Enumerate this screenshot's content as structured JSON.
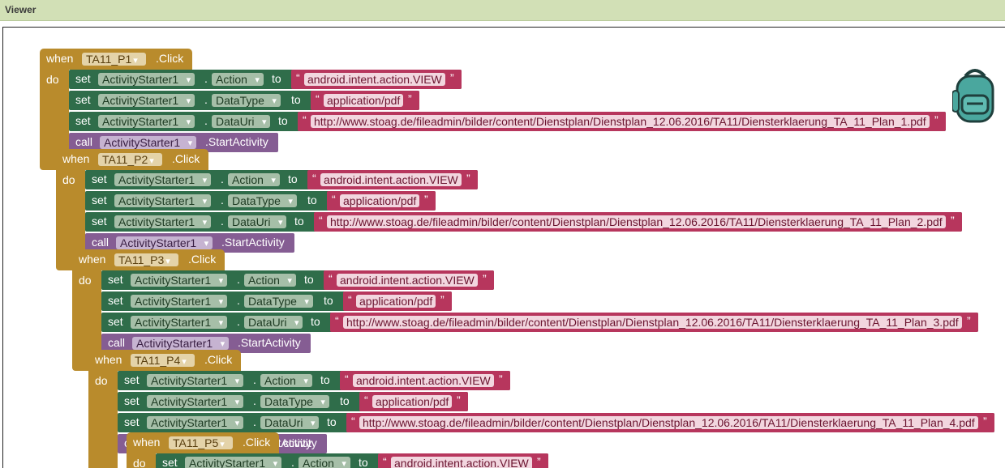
{
  "header": {
    "title": "Viewer"
  },
  "blocks": {
    "when_label": "when",
    "do_label": "do",
    "click_label": ".Click",
    "set_label": "set",
    "to_label": "to",
    "call_label": "call",
    "dot_label": ".",
    "start_activity": ".StartActivity",
    "component": "ActivityStarter1",
    "action_prop": "Action",
    "datatype_prop": "DataType",
    "datauri_prop": "DataUri",
    "action_value": "android.intent.action.VIEW",
    "datatype_value": "application/pdf",
    "quote_open": "“",
    "quote_close": "”"
  },
  "events": [
    {
      "button": "TA11_P1",
      "uri": "http://www.stoag.de/fileadmin/bilder/content/Dienstplan/Dienstplan_12.06.2016/TA11/Diensterklaerung_TA_11_Plan_1.pdf"
    },
    {
      "button": "TA11_P2",
      "uri": "http://www.stoag.de/fileadmin/bilder/content/Dienstplan/Dienstplan_12.06.2016/TA11/Diensterklaerung_TA_11_Plan_2.pdf"
    },
    {
      "button": "TA11_P3",
      "uri": "http://www.stoag.de/fileadmin/bilder/content/Dienstplan/Dienstplan_12.06.2016/TA11/Diensterklaerung_TA_11_Plan_3.pdf"
    },
    {
      "button": "TA11_P4",
      "uri": "http://www.stoag.de/fileadmin/bilder/content/Dienstplan/Dienstplan_12.06.2016/TA11/Diensterklaerung_TA_11_Plan_4.pdf"
    },
    {
      "button": "TA11_P5",
      "uri": ""
    }
  ],
  "partial_text": {
    "p4_call_tail": "ctivity"
  },
  "icons": {
    "backpack": "backpack-icon"
  },
  "colors": {
    "event": "#b98b2c",
    "setter": "#2f6d4a",
    "call": "#855d93",
    "text": "#b7365d",
    "header": "#d2e0b6"
  }
}
